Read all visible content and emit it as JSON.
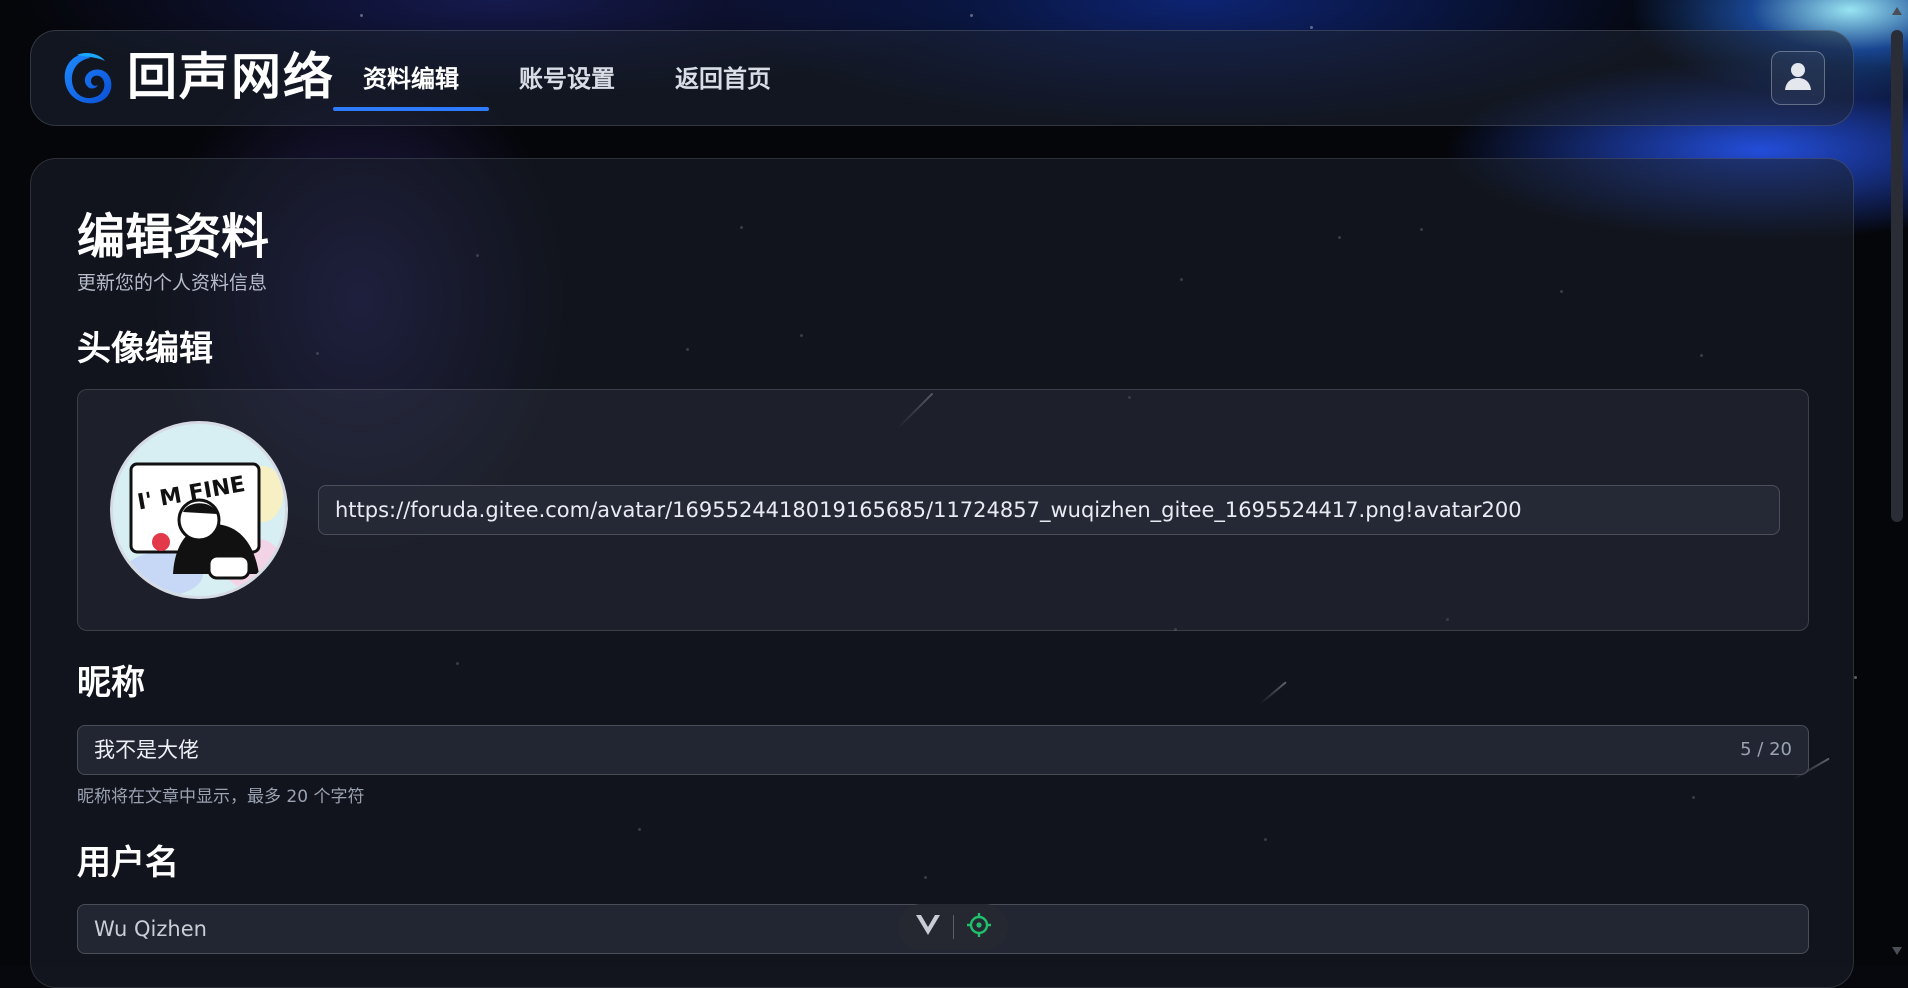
{
  "nav": {
    "brand": "回声网络",
    "tabs": [
      {
        "label": "资料编辑",
        "active": true
      },
      {
        "label": "账号设置",
        "active": false
      },
      {
        "label": "返回首页",
        "active": false
      }
    ],
    "user_icon": "user-icon",
    "logo_icon": "echo-logo-icon"
  },
  "page": {
    "title": "编辑资料",
    "subtitle": "更新您的个人资料信息"
  },
  "avatar_section": {
    "title": "头像编辑",
    "avatar_text": "I' M FINE",
    "url": "https://foruda.gitee.com/avatar/1695524418019165685/11724857_wuqizhen_gitee_1695524417.png!avatar200"
  },
  "nickname_section": {
    "title": "昵称",
    "value": "我不是大佬",
    "counter": "5 / 20",
    "hint": "昵称将在文章中显示，最多 20 个字符"
  },
  "username_section": {
    "title": "用户名",
    "value": "Wu Qizhen"
  },
  "toolbar": {
    "icons": [
      "vue-devtools-icon",
      "target-icon"
    ]
  },
  "colors": {
    "accent": "#2f7bff",
    "toolbar_target": "#1fbf6b"
  }
}
